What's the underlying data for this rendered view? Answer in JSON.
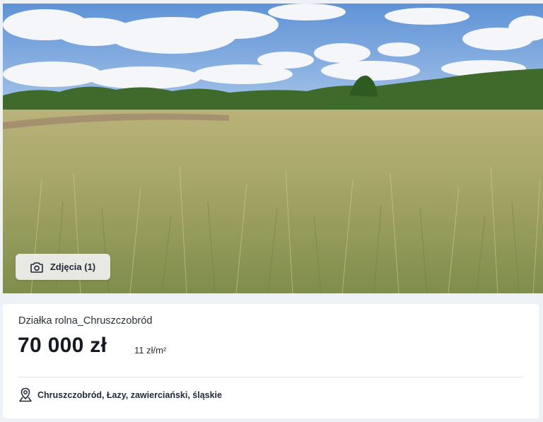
{
  "listing": {
    "photos_button_label": "Zdjęcia (1)",
    "title": "Działka rolna_Chruszczobród",
    "price": "70 000 zł",
    "price_per_m2": "11 zł/m²",
    "location": "Chruszczobród, Łazy, zawierciański, śląskie"
  },
  "icons": {
    "photos": "camera-icon",
    "location": "map-pin-icon"
  },
  "colors": {
    "page_background": "#eef1f5",
    "card_background": "#ffffff",
    "text_primary": "#151a22"
  }
}
